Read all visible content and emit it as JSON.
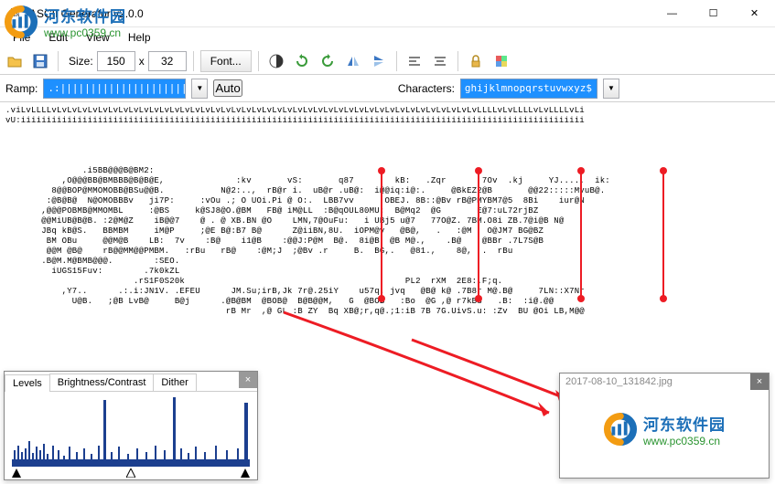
{
  "window": {
    "title": "ASCII Generator v2.0.0",
    "min_icon": "—",
    "max_icon": "☐",
    "close_icon": "✕"
  },
  "menu": {
    "file": "File",
    "edit": "Edit",
    "view": "View",
    "help": "Help"
  },
  "toolbar": {
    "size_label": "Size:",
    "width": "150",
    "sep": "x",
    "height": "32",
    "font_btn": "Font..."
  },
  "rampbar": {
    "ramp_label": "Ramp:",
    "ramp_value": ".:|||||||||||||||||||||||||||||||||||",
    "auto_btn": "Auto",
    "chars_label": "Characters:",
    "chars_value": "ghijklmnopqrstuvwxyz$"
  },
  "ascii_art": ".viLvLLLLvLvLvLvLvLvLvLvLvLvLvLvLvLvLvLvLvLvLvLvLvLvLvLvLvLvLvLvLvLvLvLvLvLvLvLvLvLvLvLvLvLvLLLLvLvLLLLvLvLLLLvLi\nvU:iiiiiiiiiiiiiiiiiiiiiiiiiiiiiiiiiiiiiiiiiiiiiiiiiiiiiiiiiiiiiiiiiiiiiiiiiiiiiiiiiiiiiiiiiiiiiiiiiiiiiiiiiiiiii\n\n\n\n\n               .i5BB@@@B@BM2:\n           ,O@@@BB@BMBBB@B@B@E,              :kv       vS:       q87        kB:   .Zqr       7Ov  .kj     YJ.....  ik:\n         8@@BOP@MMOMOBB@BSu@@B.           N@2:..,  rB@r i.  uB@r .uB@:  i@@iq:i@:.     @BkEZ2@B       @@22:::::MvuB@.\n        :@B@B@  N@OMOBBBv   ji7P:     :vOu .; O UOi.Pi @ O:.  LBB7vv      OBEJ. 8B::@Bv rB@PMYBM7@5  8Bi    iur@N\n       ,@@@POBMB@MMOMBL     :@BS     k@SJ8@O.@BM   FB@ iM@LL  :B@qOUL80MU:  B@Mq2  @G       E@7:uL72rjBZ\n       @@MiUB@B@B. :2@M@Z    iB@@7    @ . @ XB.BN @O    LMN,7@OuFu:   i UBj5 u@7   77O@Z. 7BM.O8i ZB.7@i@B N@\n       JBq kB@S.   BBMBM     iM@P     ;@E B@:B7 B@      Z@iiBN,8U.  iOPM@v   @B@,   .   :@M   O@JM7 BG@BZ\n        BM OBu     @@M@B    LB:  7v    :B@    i1@B    :@@J:P@M  B@.  8i@B  @B M@.,    .B@    @BBr .7L7S@B\n        @@M @B@    rB@@MM@@PMBM.   :rBu   rB@    :@M;J  ;@Bv .r     B.  BG,.   @81.,    8@,  .  rBu\n       .B@M.M@BMB@@@.        :SEO.\n         iUGS15Fuv:        .7k0kZL\n                         .rS1F0S20k                                           PL2  rXM  2E8:.F;q.\n           ,Y7..      .:.i:JN1V. .EFEU      JM.Su;irB,Jk 7r@.25iY    u57q. jvq   @B@ k@ .7B8r M@.B@     7LN::X7Nr\n             U@B.   ;@B LvB@     B@j      .@B@BM  @BOB@  B@B@@M,   G  @BOB   :Bo  @G ,@ r7kBS   .B:  :i@.@@\n                                           rB Mr  ,@ GL :B ZY  Bq XB@;r,q@.;1:iB 7B 7G.UivS.u: :Zv  BU @Oi LB,M@@",
  "levels": {
    "close": "×",
    "tab1": "Levels",
    "tab2": "Brightness/Contrast",
    "tab3": "Dither"
  },
  "preview": {
    "close": "×",
    "filename": "2017-08-10_131842.jpg"
  },
  "watermark": {
    "cn": "河东软件园",
    "url": "www.pc0359.cn"
  },
  "colors": {
    "red": "#ed1c24",
    "blue": "#1e90ff",
    "logo_blue": "#1c6fb8",
    "logo_orange": "#f39c12",
    "logo_green": "#2a9430"
  }
}
